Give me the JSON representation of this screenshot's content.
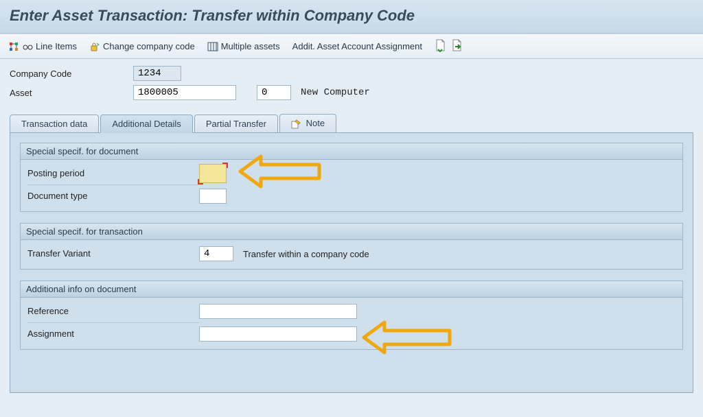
{
  "title": "Enter Asset Transaction: Transfer within Company Code",
  "toolbar": {
    "line_items": "Line Items",
    "change_company_code": "Change company code",
    "multiple_assets": "Multiple assets",
    "addit_assign": "Addit. Asset Account Assignment"
  },
  "header": {
    "company_code_label": "Company Code",
    "company_code_value": "1234",
    "asset_label": "Asset",
    "asset_value": "1800005",
    "asset_sub_value": "0",
    "asset_desc": "New Computer"
  },
  "tabs": {
    "transaction_data": "Transaction data",
    "additional_details": "Additional Details",
    "partial_transfer": "Partial Transfer",
    "note": "Note"
  },
  "groups": {
    "g1_title": "Special specif. for document",
    "posting_period_label": "Posting period",
    "document_type_label": "Document type",
    "posting_period_value": "",
    "document_type_value": "",
    "g2_title": "Special specif. for transaction",
    "transfer_variant_label": "Transfer Variant",
    "transfer_variant_value": "4",
    "transfer_variant_desc": "Transfer within a company code",
    "g3_title": "Additional info on document",
    "reference_label": "Reference",
    "assignment_label": "Assignment",
    "reference_value": "",
    "assignment_value": ""
  }
}
